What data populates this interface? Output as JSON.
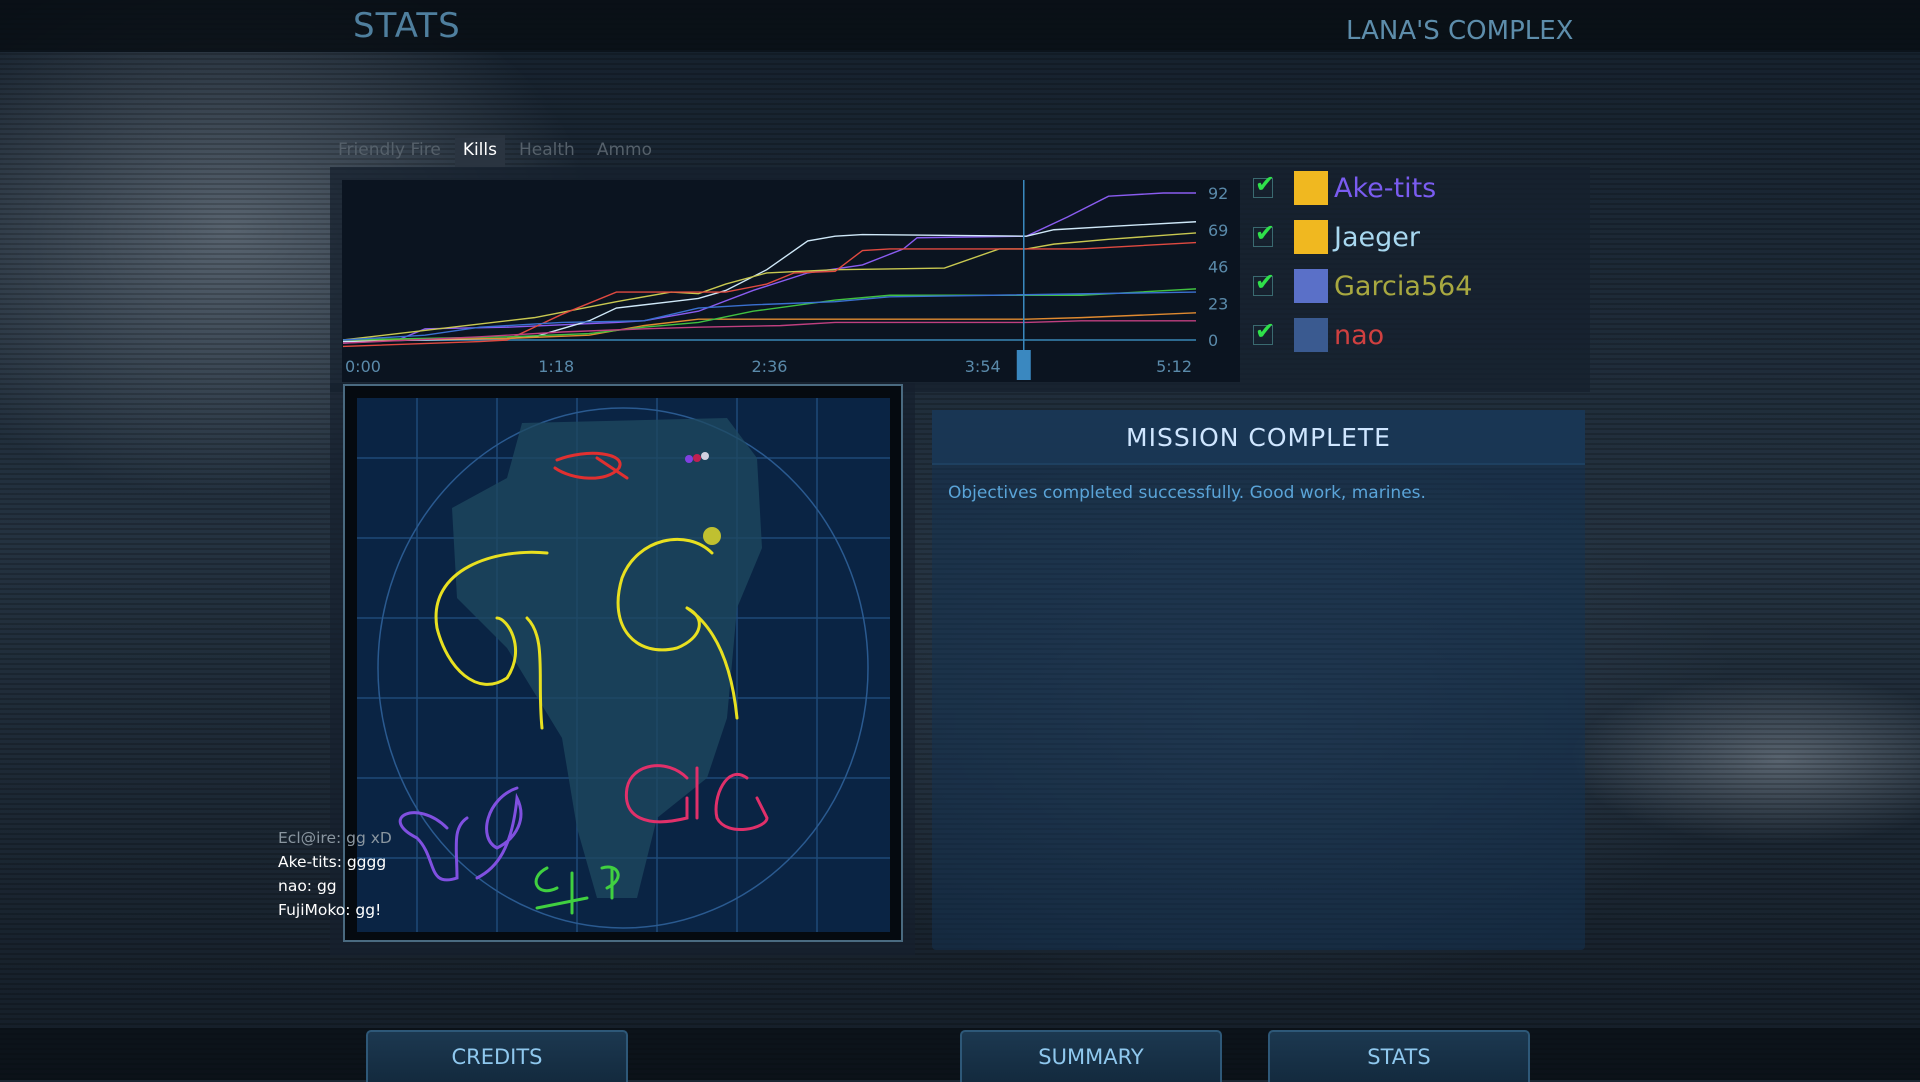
{
  "header": {
    "title": "STATS",
    "map_name": "LANA'S COMPLEX"
  },
  "tabs": [
    {
      "label": "Friendly Fire",
      "active": false
    },
    {
      "label": "Kills",
      "active": true
    },
    {
      "label": "Health",
      "active": false
    },
    {
      "label": "Ammo",
      "active": false
    }
  ],
  "players": [
    {
      "name": "Ake-tits",
      "color": "#7a5cf0",
      "checked": true,
      "avatar": "yellow-cartoon-avatar"
    },
    {
      "name": "Jaeger",
      "color": "#a8d8f0",
      "checked": true,
      "avatar": "yellow-cartoon-avatar"
    },
    {
      "name": "Garcia564",
      "color": "#a8a840",
      "checked": true,
      "avatar": "anime-girl-avatar"
    },
    {
      "name": "nao",
      "color": "#d04040",
      "checked": true,
      "avatar": "blue-space-avatar"
    }
  ],
  "chart_data": {
    "type": "line",
    "title": "",
    "xlabel": "",
    "ylabel": "",
    "x_ticks": [
      "0:00",
      "1:18",
      "2:36",
      "3:54",
      "5:12"
    ],
    "y_ticks": [
      "0",
      "23",
      "46",
      "69",
      "92"
    ],
    "xlim_seconds": [
      0,
      312
    ],
    "ylim": [
      0,
      92
    ],
    "cursor_time": "4:09",
    "grid": false,
    "series": [
      {
        "name": "Ake-tits",
        "color": "#8a5cf0",
        "points": [
          [
            0,
            -2
          ],
          [
            20,
            0
          ],
          [
            30,
            7
          ],
          [
            60,
            8
          ],
          [
            100,
            11
          ],
          [
            110,
            12
          ],
          [
            130,
            18
          ],
          [
            150,
            31
          ],
          [
            170,
            42
          ],
          [
            190,
            47
          ],
          [
            205,
            57
          ],
          [
            210,
            64
          ],
          [
            250,
            65
          ],
          [
            265,
            77
          ],
          [
            280,
            90
          ],
          [
            300,
            92
          ],
          [
            312,
            92
          ]
        ]
      },
      {
        "name": "Jaeger",
        "color": "#cfe8f8",
        "points": [
          [
            0,
            -1
          ],
          [
            60,
            1
          ],
          [
            70,
            2
          ],
          [
            90,
            12
          ],
          [
            100,
            20
          ],
          [
            120,
            24
          ],
          [
            130,
            26
          ],
          [
            140,
            31
          ],
          [
            155,
            44
          ],
          [
            170,
            62
          ],
          [
            180,
            65
          ],
          [
            190,
            66
          ],
          [
            250,
            65
          ],
          [
            260,
            69
          ],
          [
            280,
            71
          ],
          [
            312,
            74
          ]
        ]
      },
      {
        "name": "Garcia564",
        "color": "#c8c850",
        "points": [
          [
            0,
            0
          ],
          [
            10,
            2
          ],
          [
            40,
            8
          ],
          [
            70,
            14
          ],
          [
            100,
            24
          ],
          [
            120,
            30
          ],
          [
            130,
            29
          ],
          [
            140,
            35
          ],
          [
            155,
            42
          ],
          [
            180,
            44
          ],
          [
            220,
            45
          ],
          [
            240,
            57
          ],
          [
            250,
            57
          ],
          [
            260,
            60
          ],
          [
            280,
            63
          ],
          [
            312,
            67
          ]
        ]
      },
      {
        "name": "nao",
        "color": "#e04a40",
        "points": [
          [
            0,
            -4
          ],
          [
            50,
            -1
          ],
          [
            60,
            0
          ],
          [
            70,
            8
          ],
          [
            80,
            16
          ],
          [
            100,
            30
          ],
          [
            140,
            30
          ],
          [
            155,
            35
          ],
          [
            165,
            42
          ],
          [
            180,
            43
          ],
          [
            190,
            56
          ],
          [
            200,
            57
          ],
          [
            270,
            57
          ],
          [
            312,
            61
          ]
        ]
      },
      {
        "color": "#e08a30",
        "points": [
          [
            0,
            0
          ],
          [
            60,
            1
          ],
          [
            90,
            3
          ],
          [
            110,
            9
          ],
          [
            130,
            13
          ],
          [
            200,
            13
          ],
          [
            250,
            13
          ],
          [
            270,
            14
          ],
          [
            312,
            17
          ]
        ]
      },
      {
        "color": "#40c040",
        "points": [
          [
            0,
            0
          ],
          [
            60,
            2
          ],
          [
            90,
            4
          ],
          [
            110,
            8
          ],
          [
            130,
            11
          ],
          [
            150,
            18
          ],
          [
            180,
            25
          ],
          [
            200,
            28
          ],
          [
            270,
            28
          ],
          [
            312,
            32
          ]
        ]
      },
      {
        "color": "#3a70d0",
        "points": [
          [
            0,
            0
          ],
          [
            30,
            3
          ],
          [
            50,
            8
          ],
          [
            80,
            11
          ],
          [
            110,
            12
          ],
          [
            130,
            20
          ],
          [
            150,
            22
          ],
          [
            180,
            24
          ],
          [
            200,
            27
          ],
          [
            312,
            30
          ]
        ]
      },
      {
        "color": "#c04080",
        "points": [
          [
            0,
            -2
          ],
          [
            50,
            2
          ],
          [
            80,
            5
          ],
          [
            110,
            7
          ],
          [
            130,
            8
          ],
          [
            160,
            9
          ],
          [
            180,
            11
          ],
          [
            250,
            11
          ],
          [
            270,
            12
          ],
          [
            312,
            12
          ]
        ]
      }
    ]
  },
  "mission": {
    "title": "MISSION COMPLETE",
    "text": "Objectives completed successfully.  Good work, marines."
  },
  "chat": [
    {
      "text": "Ecl@ire: gg xD",
      "color": "#8a96a0"
    },
    {
      "text": "Ake-tits: gggg",
      "color": "#ffffff"
    },
    {
      "text": "nao: gg",
      "color": "#ffffff"
    },
    {
      "text": "FujiMoko: gg!",
      "color": "#ffffff"
    }
  ],
  "buttons": {
    "credits": "CREDITS",
    "summary": "SUMMARY",
    "stats": "STATS"
  }
}
